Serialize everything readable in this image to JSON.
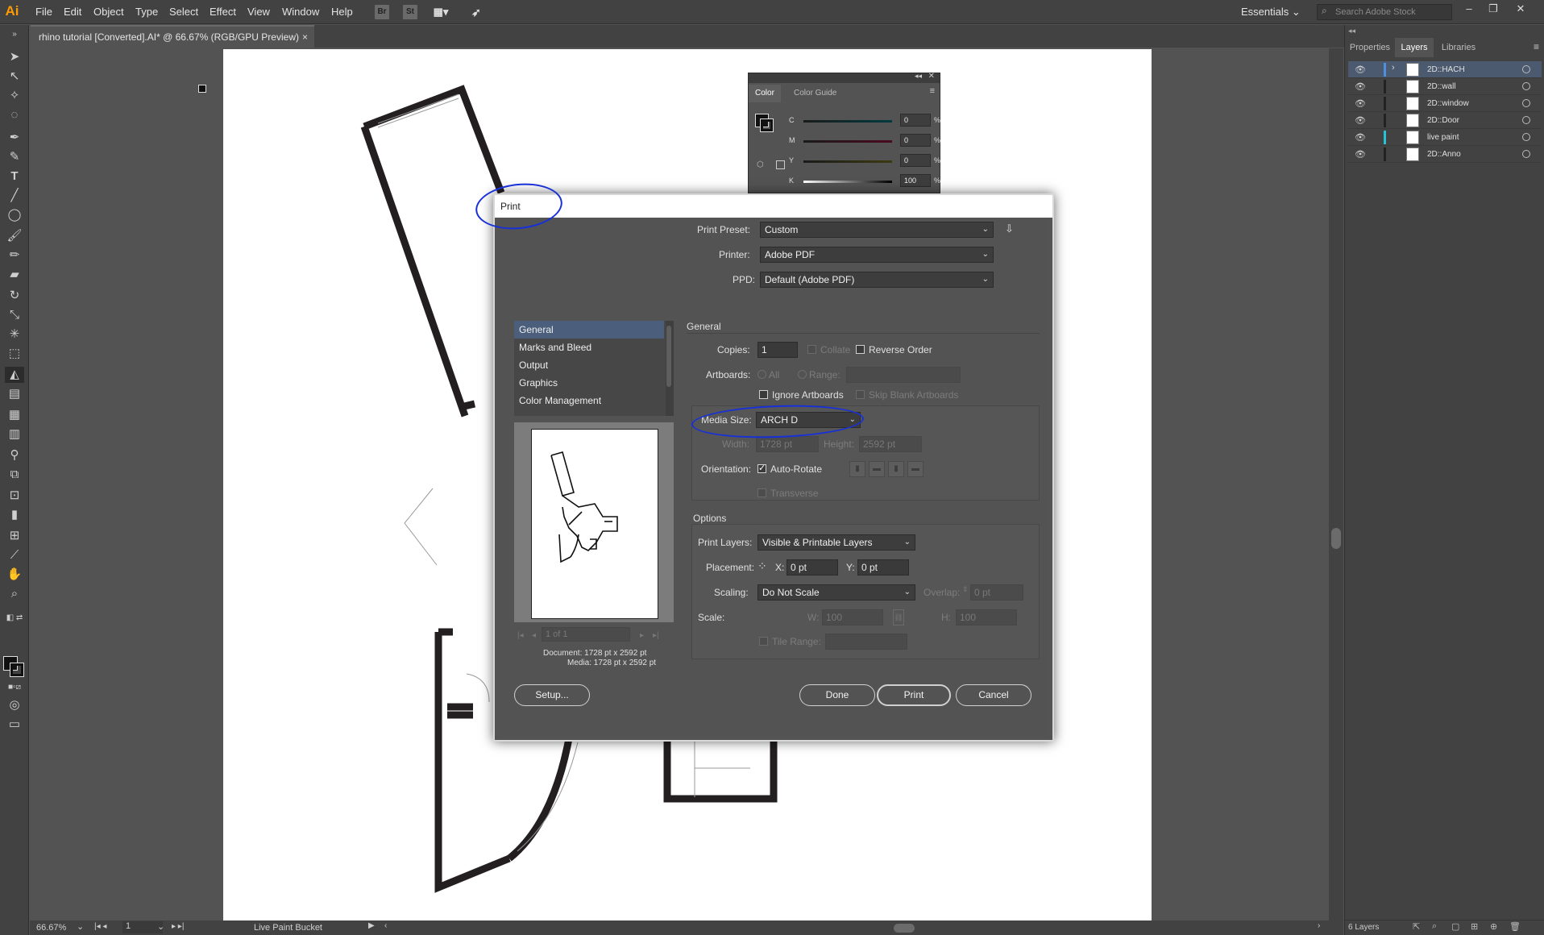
{
  "app": {
    "logo": "Ai",
    "menu": [
      "File",
      "Edit",
      "Object",
      "Type",
      "Select",
      "Effect",
      "View",
      "Window",
      "Help"
    ],
    "bridge_icon": "Br",
    "stock_icon": "St",
    "workspace": "Essentials",
    "stock_search_placeholder": "Search Adobe Stock"
  },
  "document_tab": {
    "title": "rhino tutorial [Converted].AI* @ 66.67% (RGB/GPU Preview)",
    "close": "×"
  },
  "right_panel": {
    "tabs": [
      "Properties",
      "Layers",
      "Libraries"
    ],
    "active_tab": "Layers",
    "layers": [
      {
        "name": "2D::HACH",
        "selected": true,
        "color": "#4f8fe0"
      },
      {
        "name": "2D::wall",
        "selected": false,
        "color": "#111111"
      },
      {
        "name": "2D::window",
        "selected": false,
        "color": "#111111"
      },
      {
        "name": "2D::Door",
        "selected": false,
        "color": "#111111"
      },
      {
        "name": "live paint",
        "selected": false,
        "color": "#27c3d8"
      },
      {
        "name": "2D::Anno",
        "selected": false,
        "color": "#111111"
      }
    ],
    "layer_count": "6 Layers"
  },
  "color_panel": {
    "tabs": [
      "Color",
      "Color Guide"
    ],
    "sliders": [
      {
        "label": "C",
        "value": "0",
        "unit": "%"
      },
      {
        "label": "M",
        "value": "0",
        "unit": "%"
      },
      {
        "label": "Y",
        "value": "0",
        "unit": "%"
      },
      {
        "label": "K",
        "value": "100",
        "unit": "%"
      }
    ]
  },
  "status_bar": {
    "zoom": "66.67%",
    "artboard": "1",
    "tool": "Live Paint Bucket"
  },
  "print_dialog": {
    "title": "Print",
    "preset_label": "Print Preset:",
    "preset_value": "Custom",
    "printer_label": "Printer:",
    "printer_value": "Adobe PDF",
    "ppd_label": "PPD:",
    "ppd_value": "Default (Adobe PDF)",
    "categories": [
      "General",
      "Marks and Bleed",
      "Output",
      "Graphics",
      "Color Management"
    ],
    "selected_category": "General",
    "page_nav": "1 of 1",
    "document_info": "Document: 1728 pt x 2592 pt",
    "media_info": "Media: 1728 pt x 2592 pt",
    "general": {
      "heading": "General",
      "copies_label": "Copies:",
      "copies_value": "1",
      "collate_label": "Collate",
      "reverse_order_label": "Reverse Order",
      "artboards_label": "Artboards:",
      "all_label": "All",
      "range_label": "Range:",
      "ignore_artboards_label": "Ignore Artboards",
      "skip_blank_label": "Skip Blank Artboards",
      "media_size_label": "Media Size:",
      "media_size_value": "ARCH D",
      "width_label": "Width:",
      "width_value": "1728 pt",
      "height_label": "Height:",
      "height_value": "2592 pt",
      "orientation_label": "Orientation:",
      "auto_rotate_label": "Auto-Rotate",
      "transverse_label": "Transverse"
    },
    "options": {
      "heading": "Options",
      "print_layers_label": "Print Layers:",
      "print_layers_value": "Visible & Printable Layers",
      "placement_label": "Placement:",
      "x_label": "X:",
      "x_value": "0 pt",
      "y_label": "Y:",
      "y_value": "0 pt",
      "scaling_label": "Scaling:",
      "scaling_value": "Do Not Scale",
      "overlap_label": "Overlap:",
      "overlap_value": "0 pt",
      "scale_label": "Scale:",
      "w_label": "W:",
      "w_value": "100",
      "h_label": "H:",
      "h_value": "100",
      "tile_range_label": "Tile Range:"
    },
    "buttons": {
      "setup": "Setup...",
      "done": "Done",
      "print": "Print",
      "cancel": "Cancel"
    }
  }
}
